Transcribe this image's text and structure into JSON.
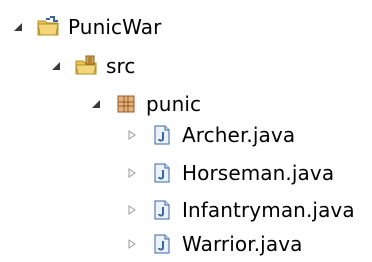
{
  "tree": {
    "project": {
      "label": "PunicWar",
      "icon": "project-folder-icon",
      "expanded": true
    },
    "source_folder": {
      "label": "src",
      "icon": "source-folder-icon",
      "expanded": true
    },
    "package": {
      "label": "punic",
      "icon": "package-icon",
      "expanded": true
    },
    "files": [
      {
        "label": "Archer.java",
        "icon": "java-file-icon",
        "expanded": false
      },
      {
        "label": "Horseman.java",
        "icon": "java-file-icon",
        "expanded": false
      },
      {
        "label": "Infantryman.java",
        "icon": "java-file-icon",
        "expanded": false
      },
      {
        "label": "Warrior.java",
        "icon": "java-file-icon",
        "expanded": false
      }
    ]
  },
  "colors": {
    "text": "#000000",
    "expanded_twisty": "#3a3a3a",
    "collapsed_twisty": "#9a9a9a",
    "folder_yellow": "#e9c34f",
    "java_blue": "#3b67a8",
    "package_brown": "#b2662e"
  }
}
